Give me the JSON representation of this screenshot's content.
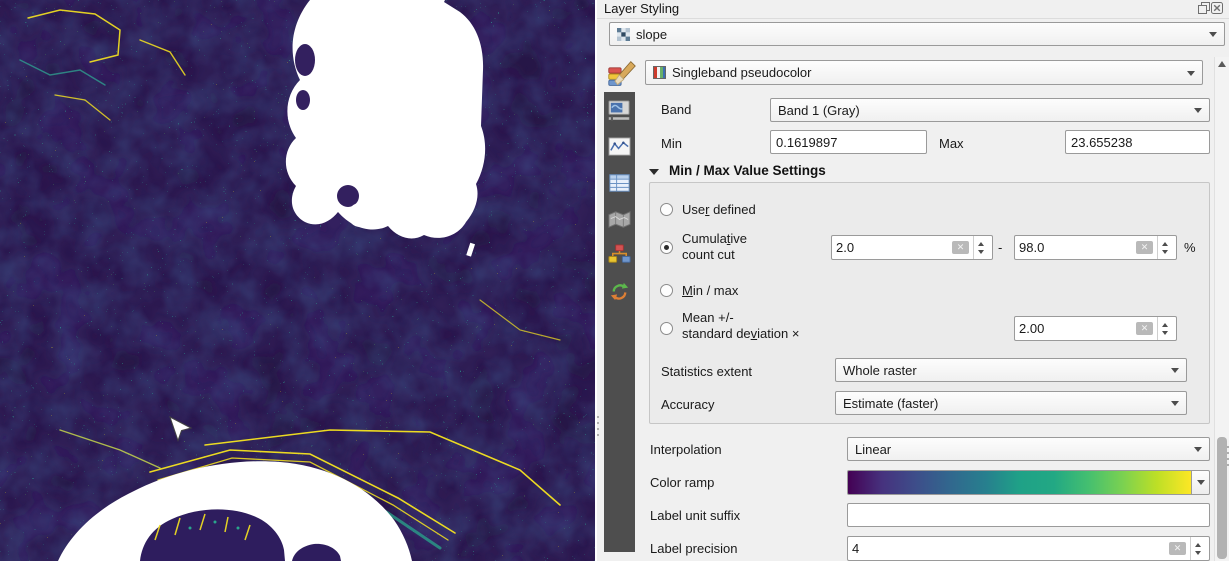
{
  "panel": {
    "title": "Layer Styling",
    "window_buttons": {
      "float_icon": "restore-icon",
      "close_icon": "close-icon"
    },
    "layer_selector": {
      "value": "slope",
      "icon": "raster-layer-icon"
    },
    "render_type": {
      "value": "Singleband pseudocolor",
      "icon": "pseudocolor-ramp-icon"
    },
    "sidebar_tabs": [
      {
        "name": "symbology",
        "icon": "paintbrush-icon",
        "selected": true
      },
      {
        "name": "transparency",
        "icon": "monitor-slider-icon",
        "selected": false
      },
      {
        "name": "histogram",
        "icon": "histogram-icon",
        "selected": false
      },
      {
        "name": "attribute-table",
        "icon": "table-icon",
        "selected": false
      },
      {
        "name": "overviews",
        "icon": "folded-map-icon",
        "selected": false
      },
      {
        "name": "style-manager",
        "icon": "brush-hierarchy-icon",
        "selected": false
      },
      {
        "name": "history",
        "icon": "undo-redo-arrows-icon",
        "selected": false
      }
    ],
    "band": {
      "label": "Band",
      "value": "Band 1 (Gray)"
    },
    "min": {
      "label": "Min",
      "value": "0.1619897"
    },
    "max": {
      "label": "Max",
      "value": "23.655238"
    },
    "minmax": {
      "header": "Min / Max Value Settings",
      "user_defined": {
        "pre": "Use",
        "mn": "r",
        "post": " defined",
        "selected": false
      },
      "cumulative": {
        "l1pre": "Cumula",
        "l1mn": "t",
        "l1post": "ive",
        "line2": "count cut",
        "selected": true,
        "from": "2.0",
        "sep": "-",
        "to": "98.0",
        "unit": "%"
      },
      "min_max": {
        "pre": "",
        "mn": "M",
        "post": "in / max",
        "selected": false
      },
      "mean_std": {
        "line1": "Mean +/-",
        "l2pre": "standard de",
        "l2mn": "v",
        "l2post": "iation ×",
        "selected": false,
        "value": "2.00"
      },
      "statistics_extent": {
        "label": "Statistics extent",
        "value": "Whole raster"
      },
      "accuracy": {
        "label": "Accuracy",
        "value": "Estimate (faster)"
      }
    },
    "interpolation": {
      "label": "Interpolation",
      "value": "Linear"
    },
    "color_ramp": {
      "label": "Color ramp",
      "stops": [
        "#440154",
        "#46327e",
        "#3d4e8a",
        "#31688e",
        "#277f8e",
        "#1fa187",
        "#22a884",
        "#44bf70",
        "#7ad151",
        "#bddf26",
        "#fde725"
      ]
    },
    "label_unit_suffix": {
      "label": "Label unit suffix",
      "value": ""
    },
    "label_precision": {
      "label": "Label precision",
      "value": "4"
    }
  },
  "map": {
    "content": "slope raster preview (viridis pseudocolor)",
    "palette": {
      "base": "#33205f",
      "dark": "#261546",
      "blue": "#3c5288",
      "teal": "#2f9e8f",
      "green": "#67cc5c",
      "yellow": "#f7e51f",
      "nodata": "#ffffff"
    }
  }
}
